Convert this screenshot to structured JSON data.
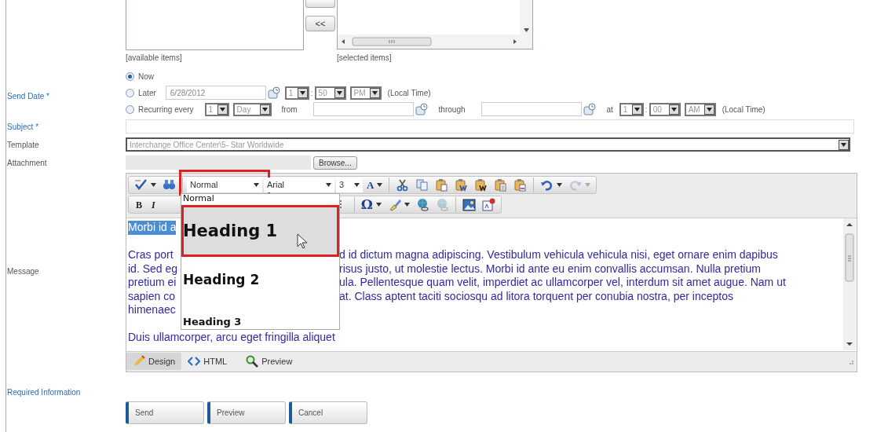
{
  "pickers": {
    "move_button": "<<",
    "available_label": "[available items]",
    "selected_label": "[selected items]"
  },
  "send_date": {
    "label": "Send Date *",
    "options": [
      {
        "label": "Now",
        "selected": true
      },
      {
        "label": "Later",
        "selected": false,
        "controls": [
          {
            "kind": "date",
            "value": "6/28/2012"
          },
          {
            "kind": "select",
            "value": "1"
          },
          {
            "kind": "sep",
            "text": ":"
          },
          {
            "kind": "select",
            "value": "50"
          },
          {
            "kind": "select",
            "value": "PM"
          },
          {
            "kind": "text",
            "text": "(Local Time)"
          }
        ]
      },
      {
        "label": "Recurring every",
        "selected": false,
        "controls": [
          {
            "kind": "select",
            "value": "1"
          },
          {
            "kind": "select",
            "value": "Day"
          },
          {
            "kind": "text",
            "text": "from"
          },
          {
            "kind": "date"
          },
          {
            "kind": "text",
            "text": "through"
          },
          {
            "kind": "date"
          },
          {
            "kind": "text",
            "text": "at"
          },
          {
            "kind": "select",
            "value": "1"
          },
          {
            "kind": "sep",
            "text": ":"
          },
          {
            "kind": "select",
            "value": "00"
          },
          {
            "kind": "select",
            "value": "AM"
          },
          {
            "kind": "text",
            "text": "(Local Time)"
          }
        ]
      }
    ]
  },
  "subject": {
    "label": "Subject *"
  },
  "template": {
    "label": "Template",
    "value": "Interchange Office Center\\5- Star Worldwide"
  },
  "attachment": {
    "label": "Attachment",
    "button": "Browse..."
  },
  "message": {
    "label": "Message",
    "toolbar_rows": [
      [
        {
          "kind": "spellcheck",
          "dropdown": true
        },
        {
          "kind": "find"
        },
        {
          "kind": "divider"
        },
        {
          "kind": "format-select",
          "value": "Normal",
          "highlighted": true
        },
        {
          "kind": "font-select",
          "value": "Arial"
        },
        {
          "kind": "size-select",
          "value": "3"
        },
        {
          "kind": "font-color",
          "label": "A",
          "dropdown": true
        },
        {
          "kind": "divider"
        },
        {
          "kind": "cut"
        },
        {
          "kind": "copy"
        },
        {
          "kind": "paste"
        },
        {
          "kind": "paste-word"
        },
        {
          "kind": "paste-word-dark"
        },
        {
          "kind": "paste-text"
        },
        {
          "kind": "paste-html"
        },
        {
          "kind": "divider"
        },
        {
          "kind": "undo",
          "dropdown": true
        },
        {
          "kind": "redo",
          "dropdown": true,
          "disabled": true
        }
      ],
      [
        {
          "kind": "bold",
          "label": "B"
        },
        {
          "kind": "italic",
          "label": "I"
        },
        {
          "kind": "hidden"
        },
        {
          "kind": "align"
        },
        {
          "kind": "divider"
        },
        {
          "kind": "symbol",
          "label": "Ω",
          "dropdown": true
        },
        {
          "kind": "brush",
          "dropdown": true
        },
        {
          "kind": "link"
        },
        {
          "kind": "unlink",
          "disabled": true
        },
        {
          "kind": "divider"
        },
        {
          "kind": "image"
        },
        {
          "kind": "media"
        }
      ]
    ],
    "format_menu": [
      {
        "kind": "normal",
        "label": "Normal",
        "selected": false
      },
      {
        "kind": "h1",
        "label": "Heading 1",
        "selected": true
      },
      {
        "kind": "h2",
        "label": "Heading 2",
        "selected": false
      },
      {
        "kind": "h3",
        "label": "Heading 3",
        "selected": false
      }
    ],
    "paragraphs": [
      [
        {
          "left": "Morbi id a",
          "selected": true
        }
      ],
      [
        {
          "left": "Cras port",
          "right": "d id dictum magna adipiscing. Vestibulum vehicula vehicula nisi, eget ornare enim dapibus"
        },
        {
          "left": "id. Sed eg",
          "right": "risus justo, ut molestie lectus. Morbi id ante eu enim convallis accumsan. Nulla pretium"
        },
        {
          "left": "pretium ei",
          "right": "ula. Pellentesque quam velit, imperdiet ac ullamcorper vel, interdum sit amet augue. Nam ut"
        },
        {
          "left": "sapien co",
          "right": "at. Class aptent taciti sociosqu ad litora torquent per conubia nostra, per inceptos"
        },
        {
          "left": "himenaec"
        }
      ],
      [
        {
          "left": "Duis ullamcorper, arcu eget fringilla aliquet"
        }
      ]
    ],
    "modes": [
      {
        "kind": "design",
        "label": "Design",
        "selected": true
      },
      {
        "kind": "html",
        "label": "HTML",
        "selected": false
      },
      {
        "kind": "preview",
        "label": "Preview",
        "selected": false
      }
    ]
  },
  "required_note": "Required Information",
  "buttons": [
    "Send",
    "Preview",
    "Cancel"
  ]
}
